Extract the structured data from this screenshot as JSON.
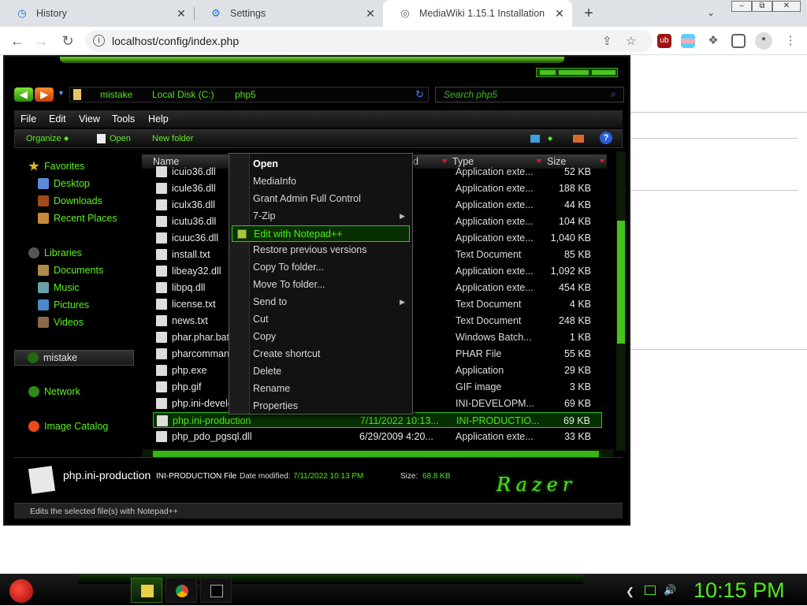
{
  "browser": {
    "tabs": [
      {
        "label": "History",
        "icon": "history-icon"
      },
      {
        "label": "Settings",
        "icon": "gear-icon"
      },
      {
        "label": "MediaWiki 1.15.1 Installation",
        "icon": "globe-icon"
      }
    ],
    "url": "localhost/config/index.php"
  },
  "explorer": {
    "breadcrumbs": [
      "mistake",
      "Local Disk (C:)",
      "php5"
    ],
    "search_placeholder": "Search php5",
    "menu": [
      "File",
      "Edit",
      "View",
      "Tools",
      "Help"
    ],
    "commands": {
      "organize": "Organize",
      "open": "Open",
      "new_folder": "New folder"
    },
    "nav": {
      "favorites": "Favorites",
      "desktop": "Desktop",
      "downloads": "Downloads",
      "recent": "Recent Places",
      "libraries": "Libraries",
      "documents": "Documents",
      "music": "Music",
      "pictures": "Pictures",
      "videos": "Videos",
      "mistake": "mistake",
      "network": "Network",
      "image_catalog": "Image Catalog"
    },
    "columns": {
      "name": "Name",
      "date": "d",
      "type": "Type",
      "size": "Size"
    },
    "files": [
      {
        "name": "icuio36.dll",
        "date": "20",
        "type": "Application exte...",
        "size": "52 KB"
      },
      {
        "name": "icule36.dll",
        "date": "20",
        "type": "Application exte...",
        "size": "188 KB"
      },
      {
        "name": "iculx36.dll",
        "date": "20",
        "type": "Application exte...",
        "size": "44 KB"
      },
      {
        "name": "icutu36.dll",
        "date": "20",
        "type": "Application exte...",
        "size": "104 KB"
      },
      {
        "name": "icuuc36.dll",
        "date": "20",
        "type": "Application exte...",
        "size": "1,040 KB"
      },
      {
        "name": "install.txt",
        "date": "20",
        "type": "Text Document",
        "size": "85 KB"
      },
      {
        "name": "libeay32.dll",
        "date": "20",
        "type": "Application exte...",
        "size": "1,092 KB"
      },
      {
        "name": "libpq.dll",
        "date": "20",
        "type": "Application exte...",
        "size": "454 KB"
      },
      {
        "name": "license.txt",
        "date": "20",
        "type": "Text Document",
        "size": "4 KB"
      },
      {
        "name": "news.txt",
        "date": "21",
        "type": "Text Document",
        "size": "248 KB"
      },
      {
        "name": "phar.phar.bat",
        "date": "20",
        "type": "Windows Batch...",
        "size": "1 KB"
      },
      {
        "name": "pharcommand",
        "date": "21",
        "type": "PHAR File",
        "size": "55 KB"
      },
      {
        "name": "php.exe",
        "date": "20",
        "type": "Application",
        "size": "29 KB"
      },
      {
        "name": "php.gif",
        "date": "20",
        "type": "GIF image",
        "size": "3 KB"
      },
      {
        "name": "php.ini-develo",
        "date": "20",
        "type": "INI-DEVELOPM...",
        "size": "69 KB"
      },
      {
        "name": "php.ini-production",
        "date": "7/11/2022 10:13...",
        "type": "INI-PRODUCTIO...",
        "size": "69 KB"
      },
      {
        "name": "php_pdo_pgsql.dll",
        "date": "6/29/2009 4:20...",
        "type": "Application exte...",
        "size": "33 KB"
      }
    ],
    "details": {
      "filename": "php.ini-production",
      "type": "INI-PRODUCTION File",
      "date_label": "Date modified:",
      "date_value": "7/11/2022 10:13 PM",
      "size_label": "Size:",
      "size_value": "68.8 KB"
    },
    "logo": "Razer",
    "status": "Edits the selected file(s) with Notepad++"
  },
  "context_menu": {
    "items": [
      {
        "label": "Open"
      },
      {
        "label": "MediaInfo"
      },
      {
        "label": "Grant Admin Full Control"
      },
      {
        "label": "7-Zip"
      },
      {
        "label": "Edit with Notepad++"
      },
      {
        "label": "Restore previous versions"
      },
      {
        "label": "Copy To folder..."
      },
      {
        "label": "Move To folder..."
      },
      {
        "label": "Send to"
      },
      {
        "label": "Cut"
      },
      {
        "label": "Copy"
      },
      {
        "label": "Create shortcut"
      },
      {
        "label": "Delete"
      },
      {
        "label": "Rename"
      },
      {
        "label": "Properties"
      }
    ]
  },
  "taskbar": {
    "clock": "10:15 PM"
  },
  "colors": {
    "accent": "#4ee51c",
    "selection_bg": "#082f02",
    "chrome_tabbar": "#dee1e6"
  }
}
